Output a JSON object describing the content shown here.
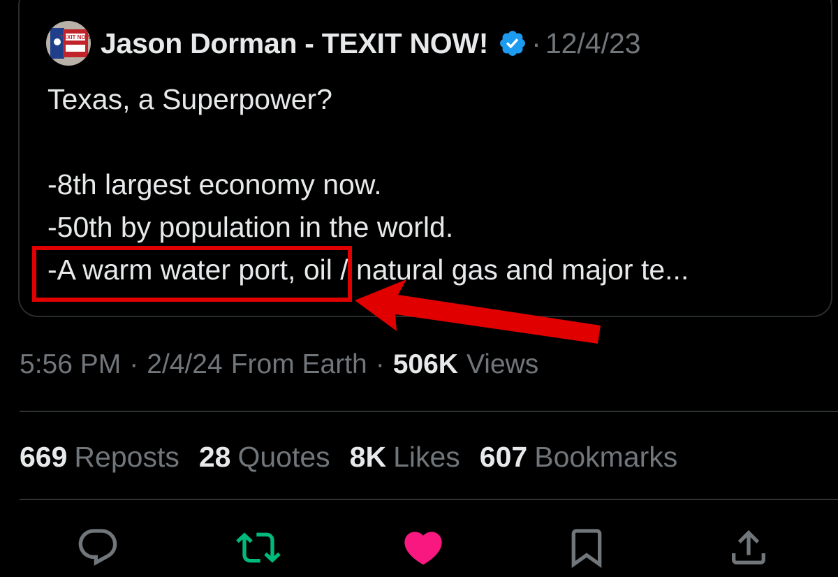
{
  "quoted_tweet": {
    "author_name": "Jason Dorman - TEXIT NOW!",
    "separator": "·",
    "date": "12/4/23",
    "avatar_text": "TEXIT NOW",
    "lines": [
      "Texas, a Superpower?",
      "",
      "-8th largest economy now.",
      "-50th by population in the world.",
      "-A warm water port, oil / natural gas and major te..."
    ]
  },
  "meta": {
    "time": "5:56 PM",
    "sep1": "·",
    "date": "2/4/24",
    "source": "From Earth",
    "sep2": "·",
    "views_count": "506K",
    "views_label": "Views"
  },
  "stats": [
    {
      "count": "669",
      "label": "Reposts"
    },
    {
      "count": "28",
      "label": "Quotes"
    },
    {
      "count": "8K",
      "label": "Likes"
    },
    {
      "count": "607",
      "label": "Bookmarks"
    }
  ],
  "colors": {
    "background": "#000000",
    "text": "#e7e9ea",
    "muted": "#71767b",
    "verified": "#1d9bf0",
    "repost": "#00ba7c",
    "like": "#f91880",
    "annotation": "#e00000"
  },
  "actions": [
    {
      "icon": "reply-icon"
    },
    {
      "icon": "repost-icon"
    },
    {
      "icon": "like-icon"
    },
    {
      "icon": "bookmark-icon"
    },
    {
      "icon": "share-icon"
    }
  ]
}
